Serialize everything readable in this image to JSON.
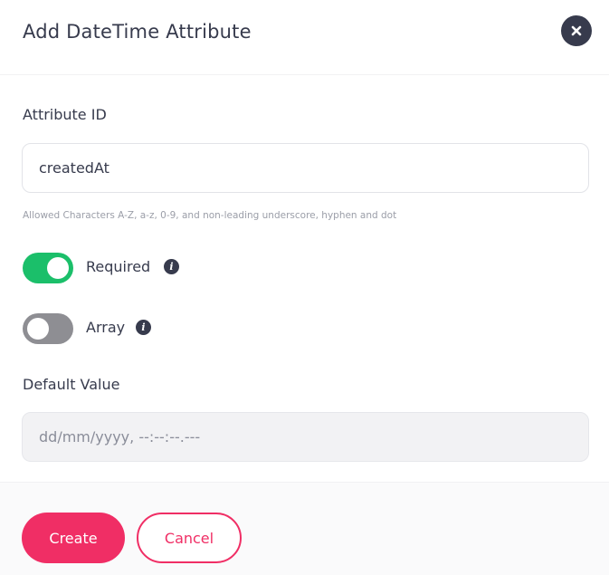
{
  "dialog": {
    "title": "Add DateTime Attribute",
    "close_icon": "close-icon"
  },
  "attribute_id": {
    "label": "Attribute ID",
    "value": "createdAt",
    "hint": "Allowed Characters A-Z, a-z, 0-9, and non-leading underscore, hyphen and dot"
  },
  "required": {
    "label": "Required",
    "enabled": true,
    "info_icon": "info-icon"
  },
  "array": {
    "label": "Array",
    "enabled": false,
    "info_icon": "info-icon"
  },
  "default_value": {
    "label": "Default Value",
    "placeholder": "dd/mm/yyyy, --:--:--.---",
    "disabled": true
  },
  "footer": {
    "create_label": "Create",
    "cancel_label": "Cancel"
  },
  "colors": {
    "accent": "#f02e65",
    "toggle_on": "#1bbf6a",
    "toggle_off": "#8e8e93",
    "text": "#373b4d"
  }
}
